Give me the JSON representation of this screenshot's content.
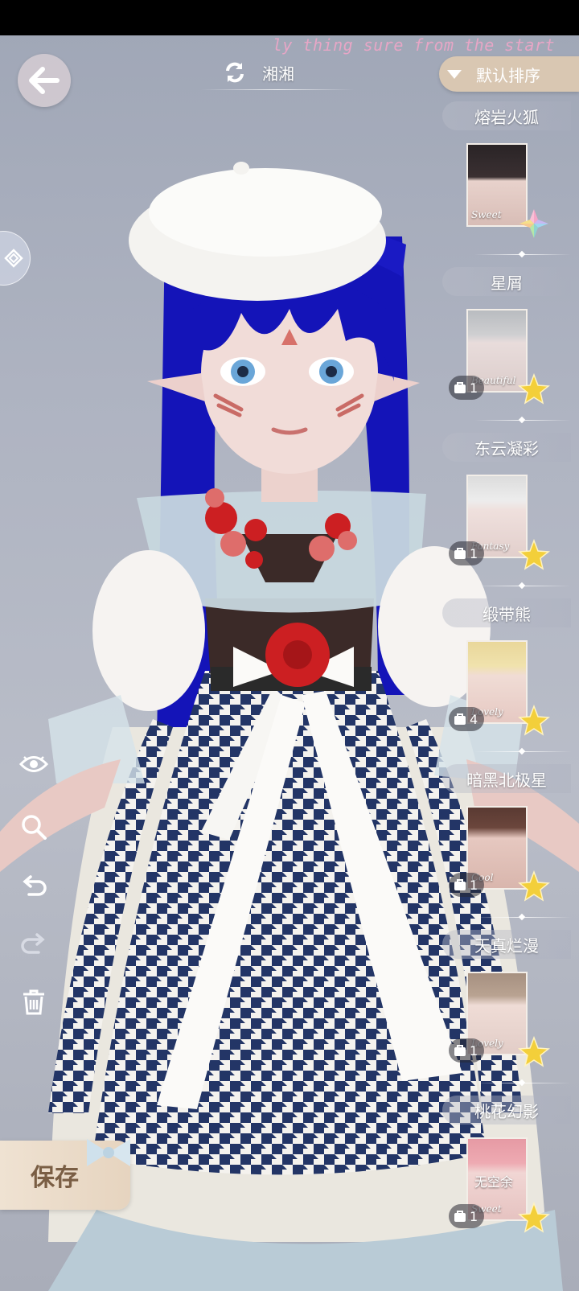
{
  "header": {
    "tagline": "ly thing sure from the start",
    "character_name": "湘湘",
    "sort_label": "默认排序"
  },
  "save": {
    "label": "保存"
  },
  "tools": [
    "eye-icon",
    "zoom-icon",
    "undo-icon",
    "redo-icon",
    "trash-icon"
  ],
  "faces": [
    {
      "name": "熔岩火狐",
      "style": "Sweet",
      "count": "",
      "rarity": "multicolor"
    },
    {
      "name": "星屑",
      "style": "Beautiful",
      "count": "1",
      "rarity": "gold"
    },
    {
      "name": "东云凝彩",
      "style": "Fantasy",
      "count": "1",
      "rarity": "gold"
    },
    {
      "name": "缎带熊",
      "style": "Lovely",
      "count": "4",
      "rarity": "gold"
    },
    {
      "name": "暗黑北极星",
      "style": "Cool",
      "count": "1",
      "rarity": "gold"
    },
    {
      "name": "天真烂漫",
      "style": "Lovely",
      "count": "1",
      "rarity": "gold"
    },
    {
      "name": "桃花幻影",
      "style": "Sweet",
      "count": "1",
      "rarity": "gold",
      "extra": "无空余"
    }
  ],
  "colors": {
    "hair": "#1414b8",
    "sort_button": "#d9c7b2",
    "save_button": "#efe2d2",
    "save_text": "#7a5e44",
    "tagline": "#e7a6c6"
  }
}
